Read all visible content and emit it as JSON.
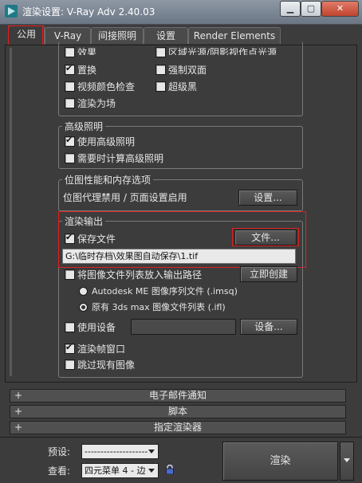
{
  "window": {
    "title": "渲染设置: V-Ray Adv 2.40.03",
    "min_label": "▁",
    "max_label": "▢",
    "close_label": "✕"
  },
  "tabs": [
    {
      "label": "公用",
      "active": true
    },
    {
      "label": "V-Ray",
      "active": false
    },
    {
      "label": "间接照明",
      "active": false
    },
    {
      "label": "设置",
      "active": false
    },
    {
      "label": "Render Elements",
      "active": false
    }
  ],
  "common_options": {
    "partial_top_left": "效果",
    "partial_top_right": "区域光源/阴影视作点光源",
    "displacement": {
      "label": "置换",
      "checked": true
    },
    "force_two_sided": {
      "label": "强制双面",
      "checked": false
    },
    "video_color_check": {
      "label": "视频颜色检查",
      "checked": false
    },
    "super_black": {
      "label": "超级黑",
      "checked": false
    },
    "render_to_fields": {
      "label": "渲染为场",
      "checked": false
    }
  },
  "advanced_lighting": {
    "title": "高级照明",
    "use": {
      "label": "使用高级照明",
      "checked": true
    },
    "compute_on_demand": {
      "label": "需要时计算高级照明",
      "checked": false
    }
  },
  "bitmap_performance": {
    "title": "位图性能和内存选项",
    "status": "位图代理禁用 / 页面设置启用",
    "setup_button": "设置..."
  },
  "render_output": {
    "title": "渲染输出",
    "save_file": {
      "label": "保存文件",
      "checked": true
    },
    "files_button": "文件...",
    "path": "G:\\临时存档\\效果图自动保存\\1.tif",
    "put_image_list": {
      "label": "将图像文件列表放入输出路径",
      "checked": false
    },
    "create_now_button": "立即创建",
    "opt_autodesk": {
      "label": "Autodesk ME 图像序列文件 (.imsq)",
      "selected": false
    },
    "opt_legacy": {
      "label": "原有 3ds max 图像文件列表 (.ifl)",
      "selected": true
    },
    "use_device": {
      "label": "使用设备",
      "checked": false
    },
    "devices_button": "设备...",
    "rendered_frame_window": {
      "label": "渲染帧窗口",
      "checked": true
    },
    "skip_existing": {
      "label": "跳过现有图像",
      "checked": false
    }
  },
  "rollouts": [
    {
      "sign": "+",
      "label": "电子邮件通知"
    },
    {
      "sign": "+",
      "label": "脚本"
    },
    {
      "sign": "+",
      "label": "指定渲染器"
    }
  ],
  "bottom": {
    "preset_label": "预设:",
    "preset_value": "--------------------",
    "view_label": "查看:",
    "view_value": "四元菜单 4 - 边",
    "render_button": "渲染"
  },
  "colors": {
    "highlight_red": "#e02020",
    "background": "#3c3c3c"
  }
}
